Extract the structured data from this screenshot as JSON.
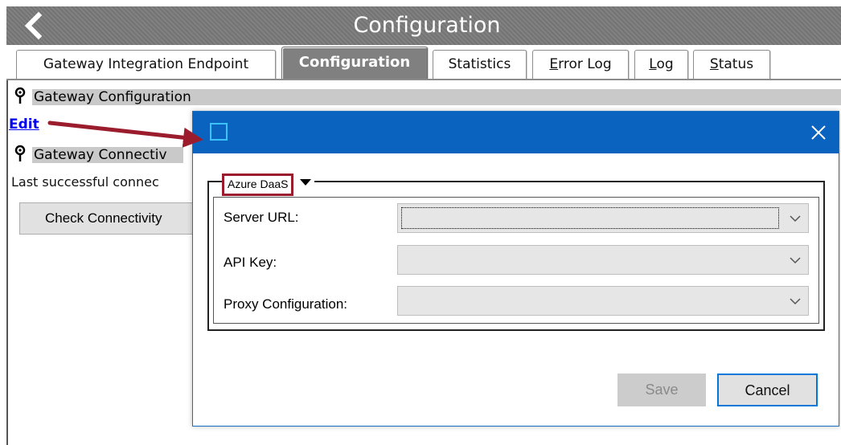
{
  "window": {
    "title": "Configuration",
    "back_icon": "chevron-left-icon"
  },
  "tabs": [
    {
      "label": "Gateway Integration Endpoint",
      "active": false
    },
    {
      "label": "Configuration",
      "active": true
    },
    {
      "label": "Statistics",
      "active": false
    },
    {
      "label": "Error Log",
      "active": false,
      "mnemonic": "E"
    },
    {
      "label": "Log",
      "active": false,
      "mnemonic": "L"
    },
    {
      "label": "Status",
      "active": false,
      "mnemonic": "S"
    }
  ],
  "main": {
    "gateway_config_label": "Gateway Configuration",
    "edit_link": "Edit",
    "gateway_connectivity_label": "Gateway Connectiv",
    "last_connection_text": "Last successful connec",
    "check_button": "Check Connectivity"
  },
  "dialog": {
    "close_icon": "close-icon",
    "group_title": "Azure DaaS",
    "fields": [
      {
        "label": "Server URL:",
        "value": ""
      },
      {
        "label": "API Key:",
        "value": ""
      },
      {
        "label": "Proxy Configuration:",
        "value": ""
      }
    ],
    "save_label": "Save",
    "cancel_label": "Cancel"
  },
  "colors": {
    "title_bar": "#7a7a7a",
    "dialog_header": "#0a64bf",
    "annotation": "#9b1c2c",
    "link": "#0000ee"
  }
}
